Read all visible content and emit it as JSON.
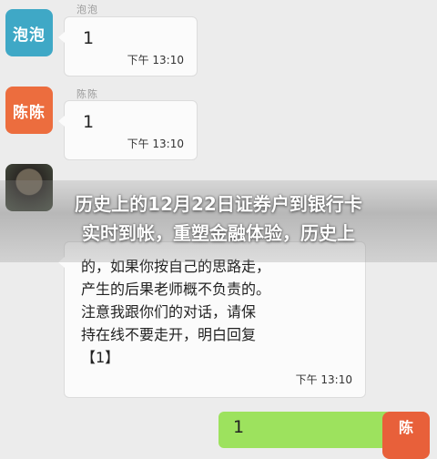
{
  "messages": [
    {
      "avatar": "泡泡",
      "sender": "泡泡",
      "content": "1",
      "time": "下午 13:10"
    },
    {
      "avatar": "陈陈",
      "sender": "陈陈",
      "content": "1",
      "time": "下午 13:10"
    },
    {
      "avatar": "",
      "sender": "",
      "content": "的，如果你按自己的思路走，\n产生的后果老师概不负责的。\n注意我跟你们的对话，请保\n持在线不要走开，明白回复\n【1】",
      "time": "下午 13:10"
    }
  ],
  "own_message": {
    "content": "1",
    "avatar": "陈"
  },
  "overlay_title": {
    "line1": "历史上的12月22日证券户到银行卡",
    "line2": "实时到帐，重塑金融体验，历史上"
  },
  "colors": {
    "avatar_blue": "#3fa8c6",
    "avatar_orange": "#ec6d3e",
    "own_bubble": "#9de25e"
  }
}
